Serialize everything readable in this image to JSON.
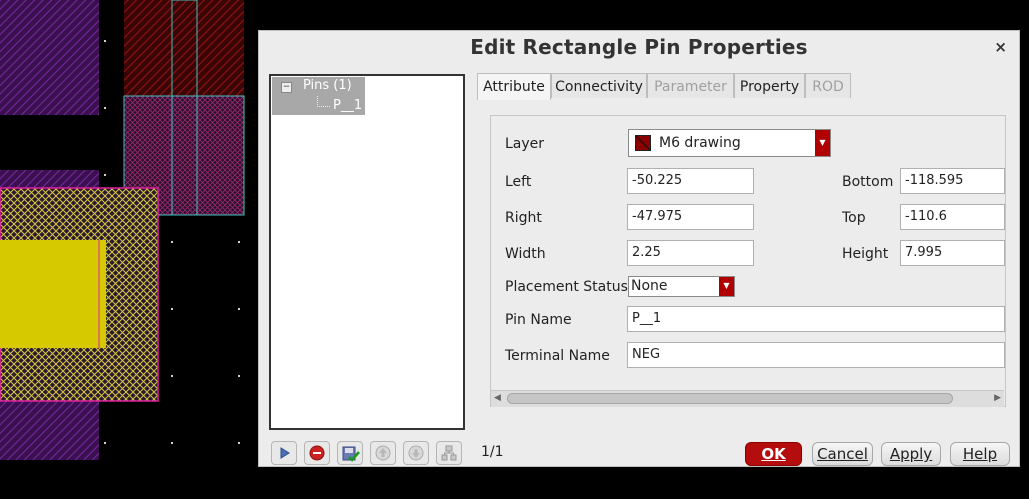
{
  "dialog": {
    "title": "Edit Rectangle Pin Properties",
    "close_glyph": "×"
  },
  "tree": {
    "root_label": "Pins (1)",
    "expander_glyph": "−",
    "child_label": "P__1"
  },
  "tabs": [
    {
      "label": "Attribute",
      "state": "active"
    },
    {
      "label": "Connectivity",
      "state": "normal"
    },
    {
      "label": "Parameter",
      "state": "disabled"
    },
    {
      "label": "Property",
      "state": "normal"
    },
    {
      "label": "ROD",
      "state": "disabled"
    }
  ],
  "attribute": {
    "layer_label": "Layer",
    "layer_value": "M6 drawing",
    "left_label": "Left",
    "left_value": "-50.225",
    "bottom_label": "Bottom",
    "bottom_value": "-118.595",
    "right_label": "Right",
    "right_value": "-47.975",
    "top_label": "Top",
    "top_value": "-110.6",
    "width_label": "Width",
    "width_value": "2.25",
    "height_label": "Height",
    "height_value": "7.995",
    "placement_label": "Placement Status",
    "placement_value": "None",
    "pin_name_label": "Pin Name",
    "pin_name_value": "P__1",
    "terminal_label": "Terminal Name",
    "terminal_value": "NEG"
  },
  "footer": {
    "page_count": "1/1",
    "ok_label": "OK",
    "cancel_label": "Cancel",
    "apply_label": "Apply",
    "help_label": "Help"
  },
  "colors": {
    "primary_button": "#b50d0d",
    "layer_swatch": "#8b0000",
    "canvas_background": "#000000",
    "metal_purple": "#6a1f8c",
    "metal_red": "#8a0e0e",
    "metal_yellow": "#d6c900",
    "outline_cyan": "#40c0c0",
    "outline_magenta": "#e020a0"
  }
}
